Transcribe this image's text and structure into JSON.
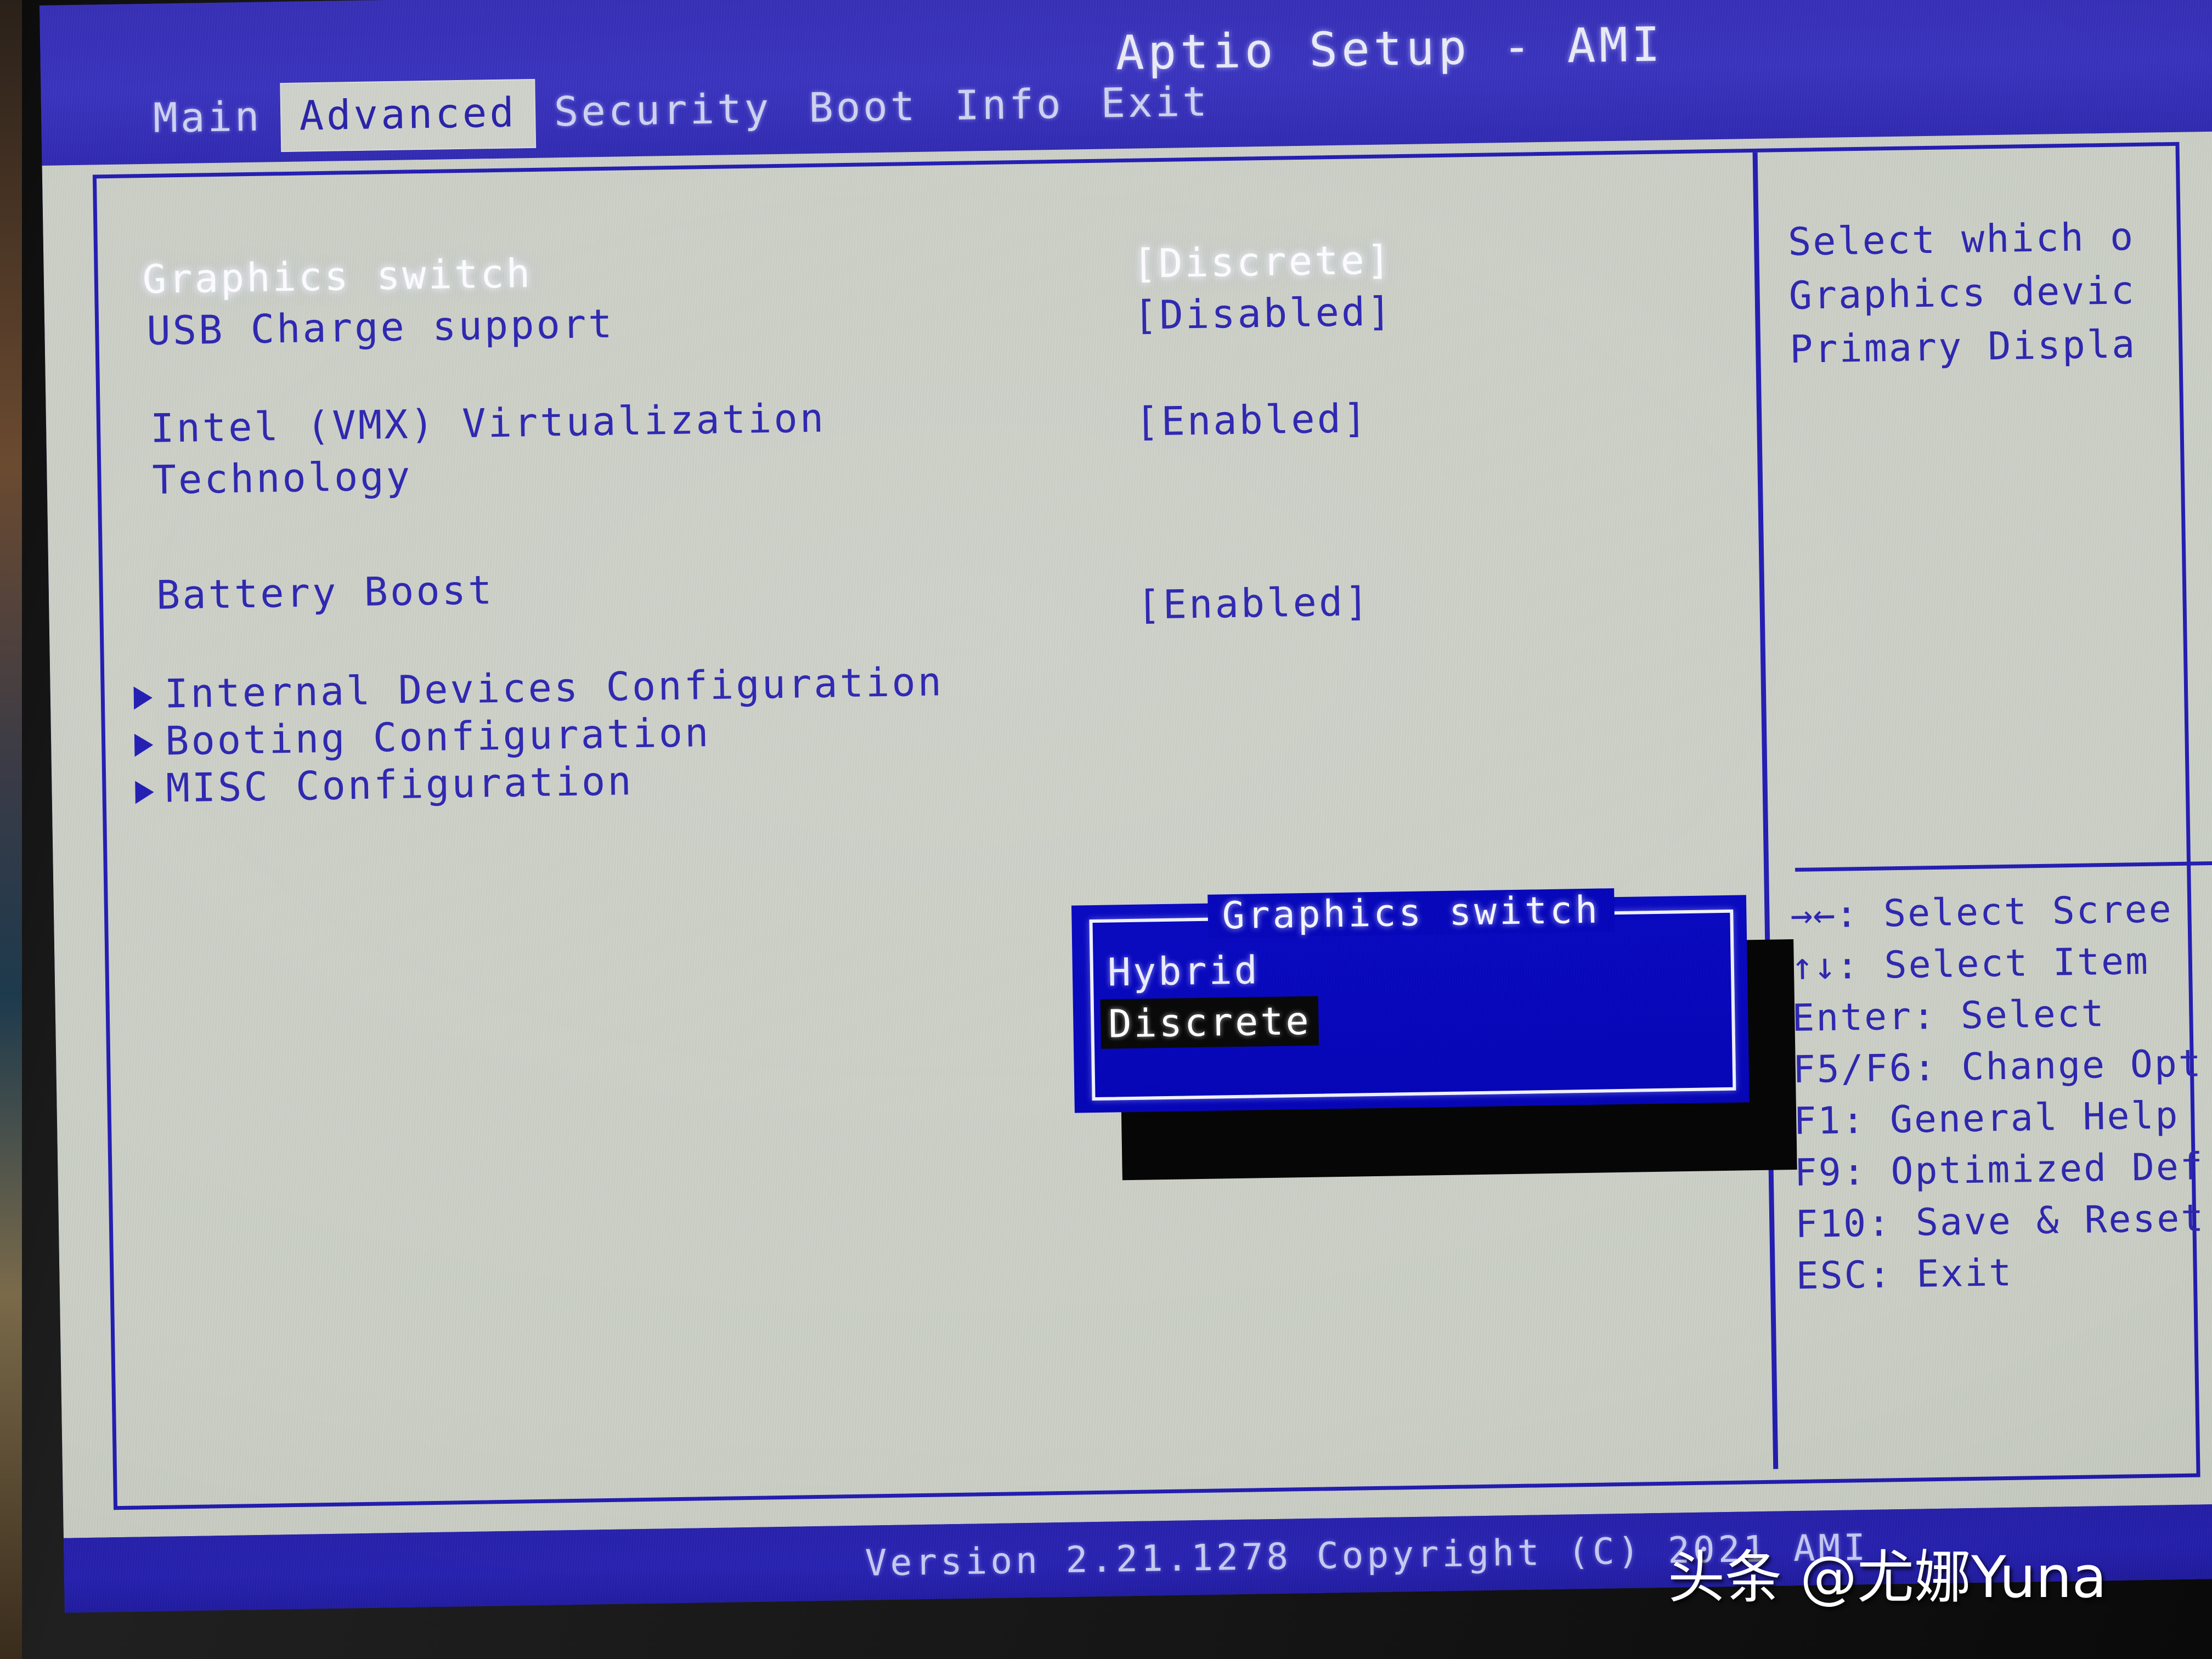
{
  "header": {
    "title": "Aptio Setup - AMI",
    "tabs": [
      {
        "label": "Main",
        "active": false
      },
      {
        "label": "Advanced",
        "active": true
      },
      {
        "label": "Security",
        "active": false
      },
      {
        "label": "Boot",
        "active": false
      },
      {
        "label": "Info",
        "active": false
      },
      {
        "label": "Exit",
        "active": false
      }
    ]
  },
  "settings": [
    {
      "label": "Graphics switch",
      "value": "[Discrete]",
      "selected": true,
      "submenu": false
    },
    {
      "label": "USB Charge support",
      "value": "[Disabled]",
      "selected": false,
      "submenu": false
    },
    {
      "label": "Intel (VMX) Virtualization",
      "value": "",
      "selected": false,
      "submenu": false
    },
    {
      "label": "Technology",
      "value": "[Enabled]",
      "selected": false,
      "submenu": false
    },
    {
      "label": "Battery Boost",
      "value": "[Enabled]",
      "selected": false,
      "submenu": false
    },
    {
      "label": "Internal Devices Configuration",
      "value": "",
      "selected": false,
      "submenu": true
    },
    {
      "label": "Booting Configuration",
      "value": "",
      "selected": false,
      "submenu": true
    },
    {
      "label": "MISC Configuration",
      "value": "",
      "selected": false,
      "submenu": true
    }
  ],
  "help": {
    "lines": [
      "Select which o",
      "Graphics devic",
      "Primary Displa"
    ]
  },
  "keys": [
    {
      "glyph": "→←",
      "text": ": Select Scree"
    },
    {
      "glyph": "↑↓",
      "text": ": Select Item"
    },
    {
      "glyph": "",
      "text": "Enter: Select"
    },
    {
      "glyph": "",
      "text": "F5/F6: Change Opt"
    },
    {
      "glyph": "",
      "text": "F1: General Help"
    },
    {
      "glyph": "",
      "text": "F9: Optimized Def"
    },
    {
      "glyph": "",
      "text": "F10: Save & Reset"
    },
    {
      "glyph": "",
      "text": "ESC: Exit"
    }
  ],
  "popup": {
    "title": "Graphics switch",
    "options": [
      {
        "label": "Hybrid",
        "selected": false
      },
      {
        "label": "Discrete",
        "selected": true
      }
    ]
  },
  "footer": {
    "text": "Version 2.21.1278 Copyright (C) 2021 AMI"
  },
  "watermark": {
    "text": "头条 @尤娜Yuna"
  },
  "colors": {
    "header_blue": "#3a34bd",
    "panel_gray": "#c9cdc4",
    "text_blue": "#2e27ae",
    "popup_blue": "#0707b8",
    "highlight_white": "#ffffff",
    "highlight_black": "#090909"
  }
}
